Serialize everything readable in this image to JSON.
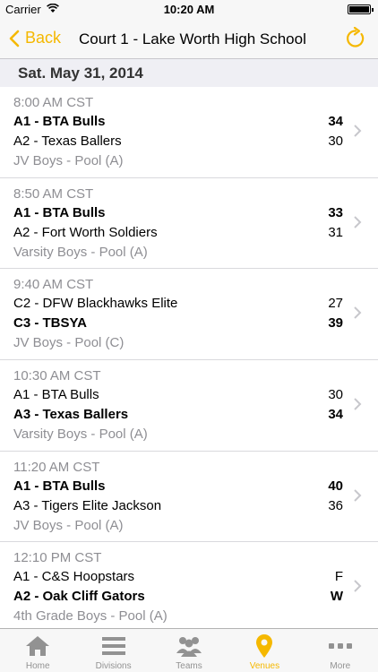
{
  "status_bar": {
    "carrier": "Carrier",
    "time": "10:20 AM"
  },
  "nav": {
    "back_label": "Back",
    "title": "Court 1 - Lake Worth High School"
  },
  "section": {
    "date": "Sat. May 31, 2014"
  },
  "games": [
    {
      "time": "8:00 AM CST",
      "team1": "A1 - BTA Bulls",
      "score1": "34",
      "team1_winner": true,
      "team2": "A2 - Texas Ballers",
      "score2": "30",
      "team2_winner": false,
      "division": "JV Boys - Pool (A)"
    },
    {
      "time": "8:50 AM CST",
      "team1": "A1 - BTA Bulls",
      "score1": "33",
      "team1_winner": true,
      "team2": "A2 - Fort Worth Soldiers",
      "score2": "31",
      "team2_winner": false,
      "division": "Varsity Boys - Pool (A)"
    },
    {
      "time": "9:40 AM CST",
      "team1": "C2 - DFW Blackhawks Elite",
      "score1": "27",
      "team1_winner": false,
      "team2": "C3 - TBSYA",
      "score2": "39",
      "team2_winner": true,
      "division": "JV Boys - Pool (C)"
    },
    {
      "time": "10:30 AM CST",
      "team1": "A1 - BTA Bulls",
      "score1": "30",
      "team1_winner": false,
      "team2": "A3 - Texas Ballers",
      "score2": "34",
      "team2_winner": true,
      "division": "Varsity Boys - Pool (A)"
    },
    {
      "time": "11:20 AM CST",
      "team1": "A1 - BTA Bulls",
      "score1": "40",
      "team1_winner": true,
      "team2": "A3 - Tigers Elite Jackson",
      "score2": "36",
      "team2_winner": false,
      "division": "JV Boys - Pool (A)"
    },
    {
      "time": "12:10 PM CST",
      "team1": "A1 - C&S Hoopstars",
      "score1": "F",
      "team1_winner": false,
      "team2": "A2 - Oak Cliff Gators",
      "score2": "W",
      "team2_winner": true,
      "division": "4th Grade Boys - Pool (A)"
    }
  ],
  "tabs": [
    {
      "label": "Home",
      "icon": "home-icon",
      "active": false
    },
    {
      "label": "Divisions",
      "icon": "list-icon",
      "active": false
    },
    {
      "label": "Teams",
      "icon": "teams-icon",
      "active": false
    },
    {
      "label": "Venues",
      "icon": "location-pin-icon",
      "active": true
    },
    {
      "label": "More",
      "icon": "more-icon",
      "active": false
    }
  ],
  "colors": {
    "accent": "#f5b800",
    "muted": "#8e8e93",
    "section_bg": "#efeff4"
  }
}
